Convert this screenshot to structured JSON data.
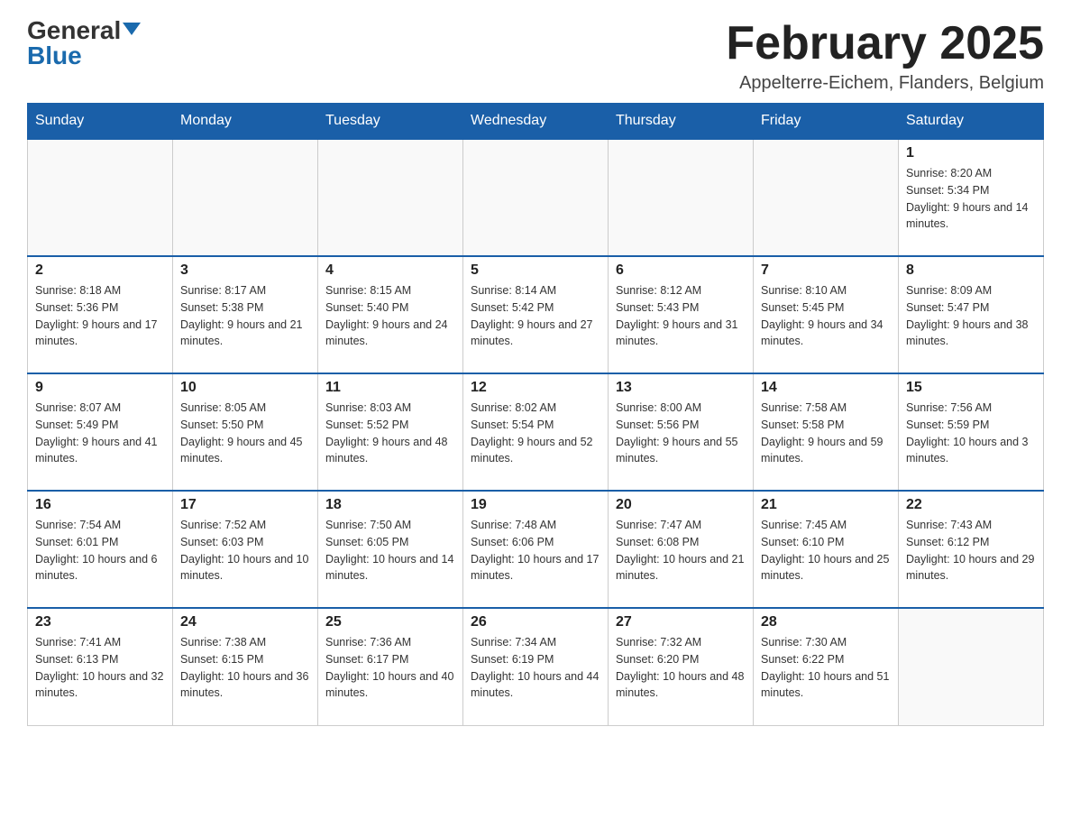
{
  "header": {
    "logo_general": "General",
    "logo_blue": "Blue",
    "month_title": "February 2025",
    "subtitle": "Appelterre-Eichem, Flanders, Belgium"
  },
  "days_of_week": [
    "Sunday",
    "Monday",
    "Tuesday",
    "Wednesday",
    "Thursday",
    "Friday",
    "Saturday"
  ],
  "weeks": [
    [
      {
        "day": "",
        "info": ""
      },
      {
        "day": "",
        "info": ""
      },
      {
        "day": "",
        "info": ""
      },
      {
        "day": "",
        "info": ""
      },
      {
        "day": "",
        "info": ""
      },
      {
        "day": "",
        "info": ""
      },
      {
        "day": "1",
        "info": "Sunrise: 8:20 AM\nSunset: 5:34 PM\nDaylight: 9 hours and 14 minutes."
      }
    ],
    [
      {
        "day": "2",
        "info": "Sunrise: 8:18 AM\nSunset: 5:36 PM\nDaylight: 9 hours and 17 minutes."
      },
      {
        "day": "3",
        "info": "Sunrise: 8:17 AM\nSunset: 5:38 PM\nDaylight: 9 hours and 21 minutes."
      },
      {
        "day": "4",
        "info": "Sunrise: 8:15 AM\nSunset: 5:40 PM\nDaylight: 9 hours and 24 minutes."
      },
      {
        "day": "5",
        "info": "Sunrise: 8:14 AM\nSunset: 5:42 PM\nDaylight: 9 hours and 27 minutes."
      },
      {
        "day": "6",
        "info": "Sunrise: 8:12 AM\nSunset: 5:43 PM\nDaylight: 9 hours and 31 minutes."
      },
      {
        "day": "7",
        "info": "Sunrise: 8:10 AM\nSunset: 5:45 PM\nDaylight: 9 hours and 34 minutes."
      },
      {
        "day": "8",
        "info": "Sunrise: 8:09 AM\nSunset: 5:47 PM\nDaylight: 9 hours and 38 minutes."
      }
    ],
    [
      {
        "day": "9",
        "info": "Sunrise: 8:07 AM\nSunset: 5:49 PM\nDaylight: 9 hours and 41 minutes."
      },
      {
        "day": "10",
        "info": "Sunrise: 8:05 AM\nSunset: 5:50 PM\nDaylight: 9 hours and 45 minutes."
      },
      {
        "day": "11",
        "info": "Sunrise: 8:03 AM\nSunset: 5:52 PM\nDaylight: 9 hours and 48 minutes."
      },
      {
        "day": "12",
        "info": "Sunrise: 8:02 AM\nSunset: 5:54 PM\nDaylight: 9 hours and 52 minutes."
      },
      {
        "day": "13",
        "info": "Sunrise: 8:00 AM\nSunset: 5:56 PM\nDaylight: 9 hours and 55 minutes."
      },
      {
        "day": "14",
        "info": "Sunrise: 7:58 AM\nSunset: 5:58 PM\nDaylight: 9 hours and 59 minutes."
      },
      {
        "day": "15",
        "info": "Sunrise: 7:56 AM\nSunset: 5:59 PM\nDaylight: 10 hours and 3 minutes."
      }
    ],
    [
      {
        "day": "16",
        "info": "Sunrise: 7:54 AM\nSunset: 6:01 PM\nDaylight: 10 hours and 6 minutes."
      },
      {
        "day": "17",
        "info": "Sunrise: 7:52 AM\nSunset: 6:03 PM\nDaylight: 10 hours and 10 minutes."
      },
      {
        "day": "18",
        "info": "Sunrise: 7:50 AM\nSunset: 6:05 PM\nDaylight: 10 hours and 14 minutes."
      },
      {
        "day": "19",
        "info": "Sunrise: 7:48 AM\nSunset: 6:06 PM\nDaylight: 10 hours and 17 minutes."
      },
      {
        "day": "20",
        "info": "Sunrise: 7:47 AM\nSunset: 6:08 PM\nDaylight: 10 hours and 21 minutes."
      },
      {
        "day": "21",
        "info": "Sunrise: 7:45 AM\nSunset: 6:10 PM\nDaylight: 10 hours and 25 minutes."
      },
      {
        "day": "22",
        "info": "Sunrise: 7:43 AM\nSunset: 6:12 PM\nDaylight: 10 hours and 29 minutes."
      }
    ],
    [
      {
        "day": "23",
        "info": "Sunrise: 7:41 AM\nSunset: 6:13 PM\nDaylight: 10 hours and 32 minutes."
      },
      {
        "day": "24",
        "info": "Sunrise: 7:38 AM\nSunset: 6:15 PM\nDaylight: 10 hours and 36 minutes."
      },
      {
        "day": "25",
        "info": "Sunrise: 7:36 AM\nSunset: 6:17 PM\nDaylight: 10 hours and 40 minutes."
      },
      {
        "day": "26",
        "info": "Sunrise: 7:34 AM\nSunset: 6:19 PM\nDaylight: 10 hours and 44 minutes."
      },
      {
        "day": "27",
        "info": "Sunrise: 7:32 AM\nSunset: 6:20 PM\nDaylight: 10 hours and 48 minutes."
      },
      {
        "day": "28",
        "info": "Sunrise: 7:30 AM\nSunset: 6:22 PM\nDaylight: 10 hours and 51 minutes."
      },
      {
        "day": "",
        "info": ""
      }
    ]
  ]
}
